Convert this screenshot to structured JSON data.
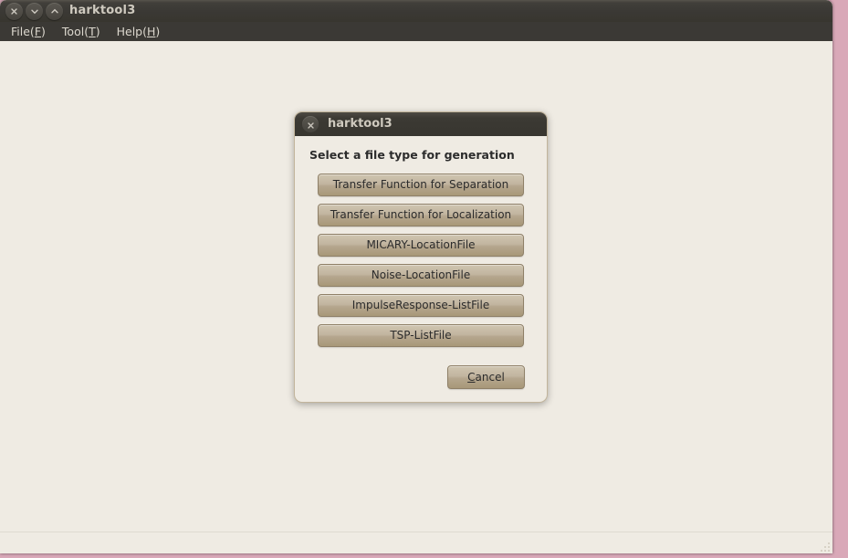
{
  "desktop": {
    "background_color": "#d9a8b8"
  },
  "app_window": {
    "title": "harktool3",
    "background_color": "#efebe3",
    "titlebar_color": "#3b3935",
    "window_buttons": [
      {
        "name": "close",
        "icon": "close-icon"
      },
      {
        "name": "minimize",
        "icon": "chevron-down-icon"
      },
      {
        "name": "maximize",
        "icon": "chevron-up-icon"
      }
    ],
    "menubar": [
      {
        "label": "File",
        "mnemonic": "F"
      },
      {
        "label": "Tool",
        "mnemonic": "T"
      },
      {
        "label": "Help",
        "mnemonic": "H"
      }
    ]
  },
  "dialog": {
    "title": "harktool3",
    "close_icon": "close-icon",
    "prompt": "Select a file type for generation",
    "file_type_buttons": [
      "Transfer Function for Separation",
      "Transfer Function for Localization",
      "MICARY-LocationFile",
      "Noise-LocationFile",
      "ImpulseResponse-ListFile",
      "TSP-ListFile"
    ],
    "cancel_label": "Cancel",
    "cancel_mnemonic": "C",
    "button_color": "#bfb29a"
  },
  "statusbar": {
    "text": ""
  }
}
